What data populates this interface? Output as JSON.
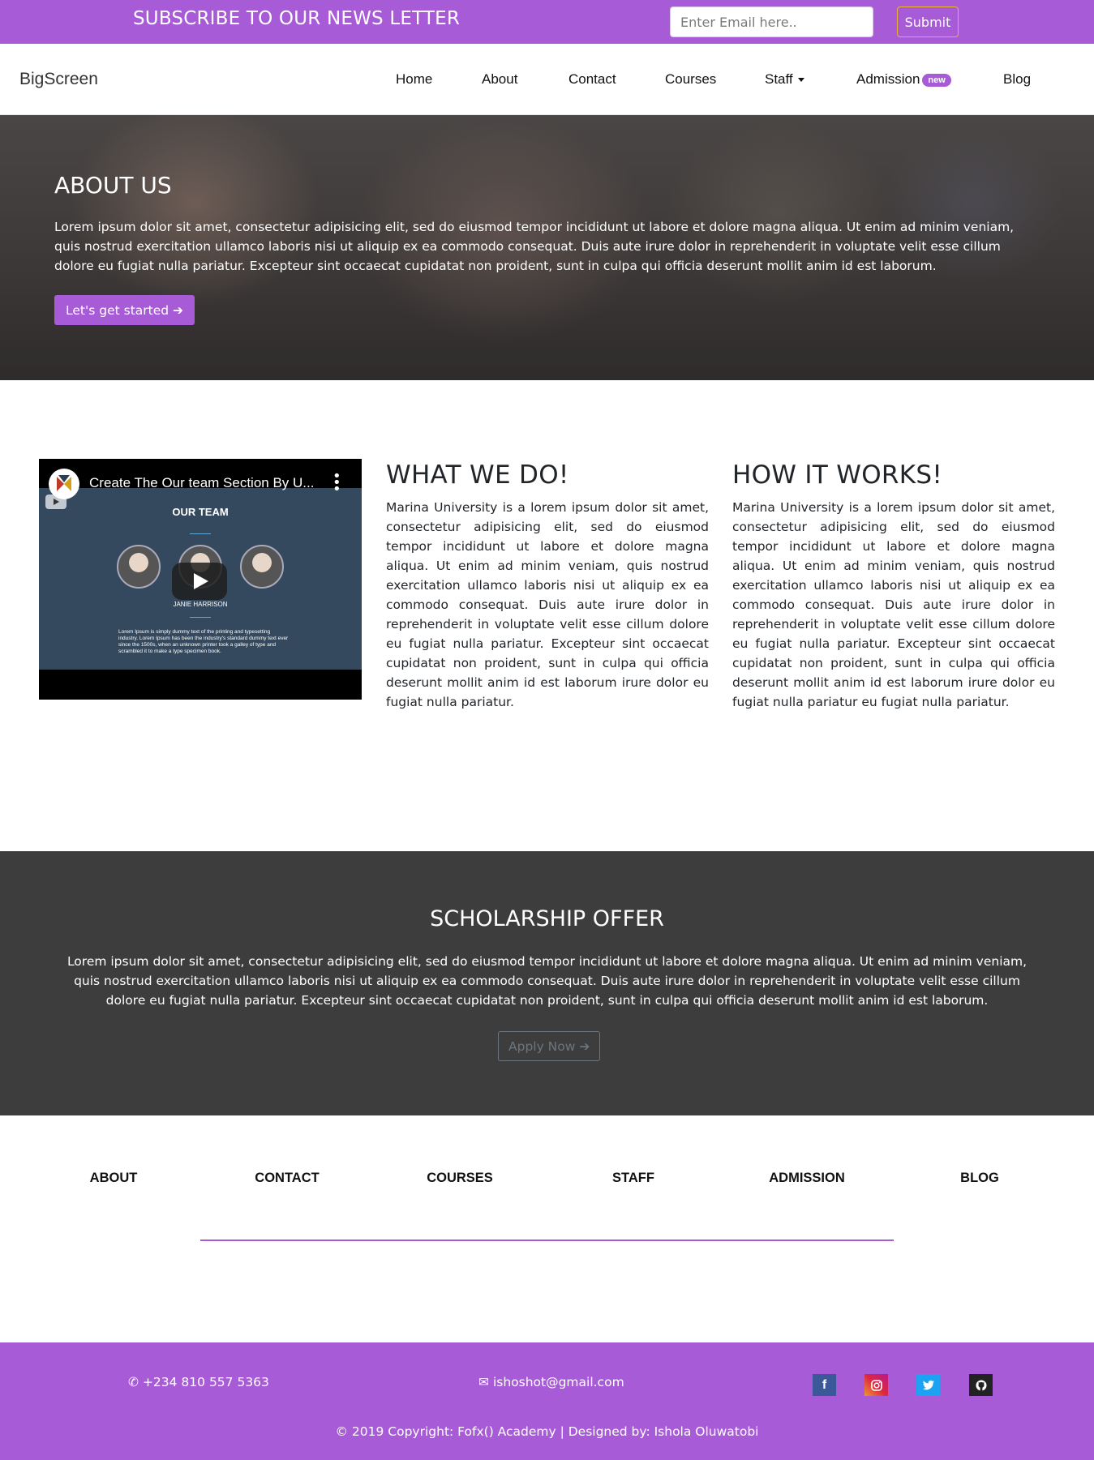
{
  "newsletter": {
    "title": "SUBSCRIBE TO OUR NEWS LETTER",
    "email_placeholder": "Enter Email here..",
    "submit_label": "Submit"
  },
  "navbar": {
    "brand": "BigScreen",
    "items": [
      {
        "label": "Home"
      },
      {
        "label": "About"
      },
      {
        "label": "Contact"
      },
      {
        "label": "Courses"
      },
      {
        "label": "Staff",
        "dropdown": true
      },
      {
        "label": "Admission",
        "badge": "new"
      },
      {
        "label": "Blog"
      }
    ]
  },
  "hero": {
    "title": "ABOUT US",
    "text": "Lorem ipsum dolor sit amet, consectetur adipisicing elit, sed do eiusmod tempor incididunt ut labore et dolore magna aliqua. Ut enim ad minim veniam, quis nostrud exercitation ullamco laboris nisi ut aliquip ex ea commodo consequat. Duis aute irure dolor in reprehenderit in voluptate velit esse cillum dolore eu fugiat nulla pariatur. Excepteur sint occaecat cupidatat non proident, sunt in culpa qui officia deserunt mollit anim id est laborum.",
    "button_label": "Let's get started"
  },
  "video": {
    "title": "Create The Our team Section By U...",
    "slide_heading": "OUR TEAM",
    "member_name": "JANIE HARRISON",
    "slide_text": "Lorem Ipsum is simply dummy text of the printing and typesetting industry. Lorem Ipsum has been the industry's standard dummy text ever since the 1500s, when an unknown printer took a galley of type and scrambled it to make a type specimen book."
  },
  "what_we_do": {
    "title": "WHAT WE DO!",
    "text": "Marina University is a lorem ipsum dolor sit amet, consectetur adipisicing elit, sed do eiusmod tempor incididunt ut labore et dolore magna aliqua. Ut enim ad minim veniam, quis nostrud exercitation ullamco laboris nisi ut aliquip ex ea commodo consequat. Duis aute irure dolor in reprehenderit in voluptate velit esse cillum dolore eu fugiat nulla pariatur. Excepteur sint occaecat cupidatat non proident, sunt in culpa qui officia deserunt mollit anim id est laborum irure dolor eu fugiat nulla pariatur."
  },
  "how_it_works": {
    "title": "HOW IT WORKS!",
    "text": "Marina University is a lorem ipsum dolor sit amet, consectetur adipisicing elit, sed do eiusmod tempor incididunt ut labore et dolore magna aliqua. Ut enim ad minim veniam, quis nostrud exercitation ullamco laboris nisi ut aliquip ex ea commodo consequat. Duis aute irure dolor in reprehenderit in voluptate velit esse cillum dolore eu fugiat nulla pariatur. Excepteur sint occaecat cupidatat non proident, sunt in culpa qui officia deserunt mollit anim id est laborum irure dolor eu fugiat nulla pariatur eu fugiat nulla pariatur."
  },
  "scholarship": {
    "title": "SCHOLARSHIP OFFER",
    "text": "Lorem ipsum dolor sit amet, consectetur adipisicing elit, sed do eiusmod tempor incididunt ut labore et dolore magna aliqua. Ut enim ad minim veniam, quis nostrud exercitation ullamco laboris nisi ut aliquip ex ea commodo consequat. Duis aute irure dolor in reprehenderit in voluptate velit esse cillum dolore eu fugiat nulla pariatur. Excepteur sint occaecat cupidatat non proident, sunt in culpa qui officia deserunt mollit anim id est laborum.",
    "button_label": "Apply Now"
  },
  "footer_links": [
    {
      "label": "ABOUT"
    },
    {
      "label": "CONTACT"
    },
    {
      "label": "COURSES"
    },
    {
      "label": "STAFF"
    },
    {
      "label": "ADMISSION"
    },
    {
      "label": "BLOG"
    }
  ],
  "footer": {
    "phone": "+234 810 557 5363",
    "email": "ishoshot@gmail.com",
    "copyright": "© 2019 Copyright: Fofx() Academy | Designed by: Ishola Oluwatobi",
    "social_icons": [
      "facebook-icon",
      "instagram-icon",
      "twitter-icon",
      "github-icon"
    ]
  },
  "colors": {
    "accent": "#a85bd6",
    "dark_section": "#3d3d3d",
    "submit_border": "#f0b13a"
  }
}
